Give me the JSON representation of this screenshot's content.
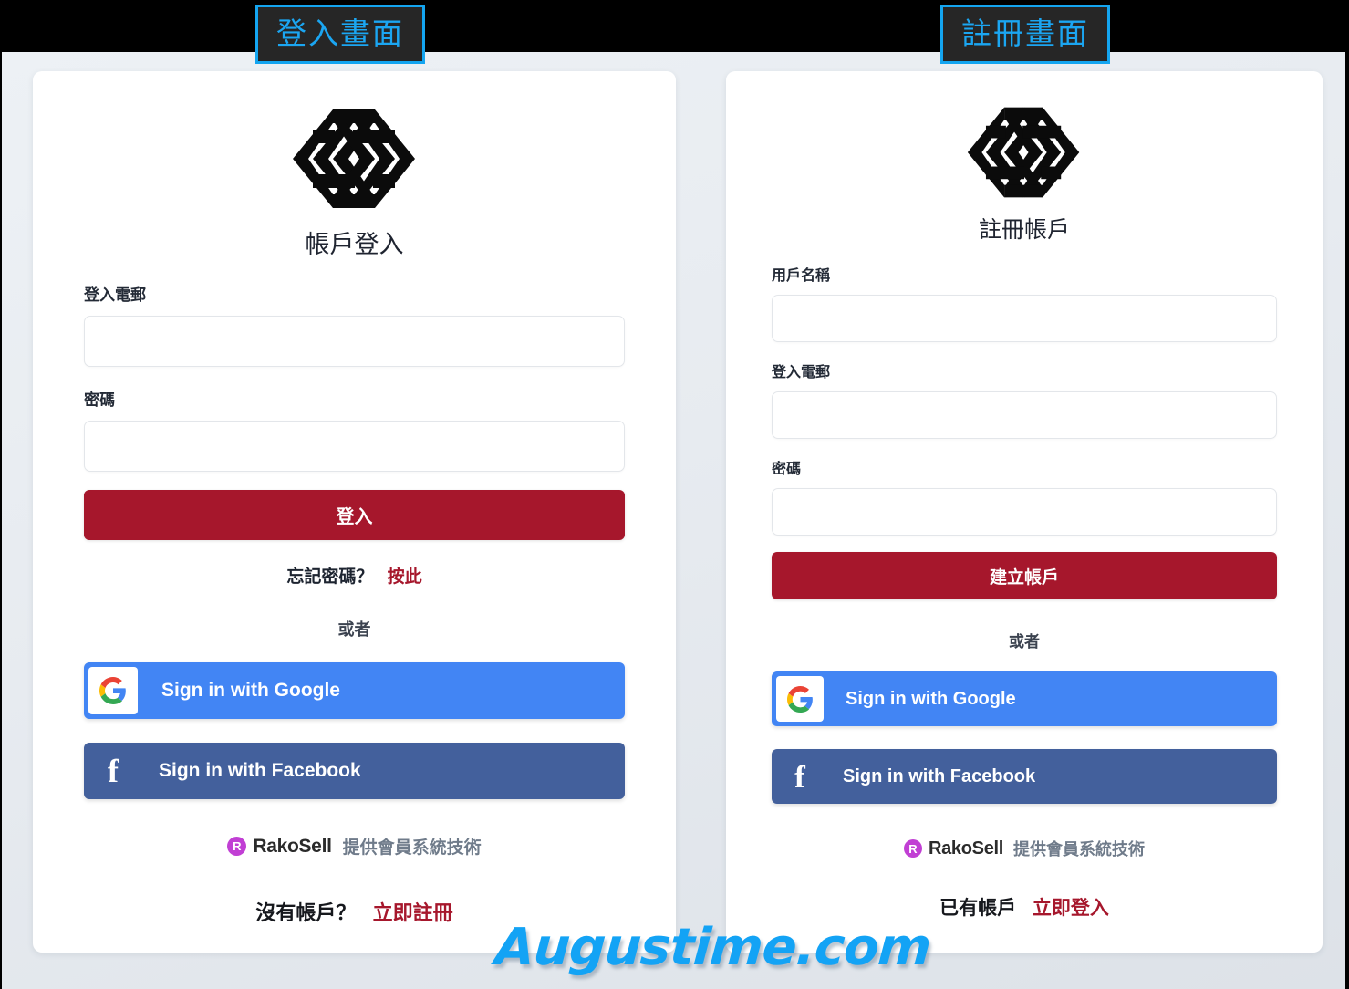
{
  "captions": {
    "login": "登入畫面",
    "register": "註冊畫面"
  },
  "colors": {
    "accent_crimson": "#A6172C",
    "caption_blue": "#1BA6F2",
    "google_blue": "#4285F4",
    "facebook_blue": "#43609C",
    "rako_purple": "#C13FD4",
    "watermark_blue": "#13A3F5",
    "page_background": "#E9EDF2"
  },
  "login_panel": {
    "logo_name": "company-hexagon-logo",
    "title": "帳戶登入",
    "fields": [
      {
        "label": "登入電郵",
        "value": "",
        "placeholder": "",
        "type": "email",
        "name": "email"
      },
      {
        "label": "密碼",
        "value": "",
        "placeholder": "",
        "type": "password",
        "name": "password"
      }
    ],
    "submit_label": "登入",
    "forgot_prompt": "忘記密碼？",
    "forgot_link": "按此",
    "or_label": "或者",
    "social": [
      {
        "label": "Sign in with Google",
        "provider": "google",
        "icon": "google-g-icon"
      },
      {
        "label": "Sign in with Facebook",
        "provider": "facebook",
        "icon": "facebook-f-icon"
      }
    ],
    "powered_by": {
      "badge": "R",
      "brand": "RakoSell",
      "tagline": "提供會員系統技術"
    },
    "footer_prompt": "沒有帳戶？",
    "footer_link": "立即註冊"
  },
  "register_panel": {
    "logo_name": "company-hexagon-logo",
    "title": "註冊帳戶",
    "fields": [
      {
        "label": "用戶名稱",
        "value": "",
        "placeholder": "",
        "type": "text",
        "name": "username"
      },
      {
        "label": "登入電郵",
        "value": "",
        "placeholder": "",
        "type": "email",
        "name": "email"
      },
      {
        "label": "密碼",
        "value": "",
        "placeholder": "",
        "type": "password",
        "name": "password"
      }
    ],
    "submit_label": "建立帳戶",
    "or_label": "或者",
    "social": [
      {
        "label": "Sign in with Google",
        "provider": "google",
        "icon": "google-g-icon"
      },
      {
        "label": "Sign in with Facebook",
        "provider": "facebook",
        "icon": "facebook-f-icon"
      }
    ],
    "powered_by": {
      "badge": "R",
      "brand": "RakoSell",
      "tagline": "提供會員系統技術"
    },
    "footer_prompt": "已有帳戶",
    "footer_link": "立即登入"
  },
  "watermark": "Augustime.com"
}
